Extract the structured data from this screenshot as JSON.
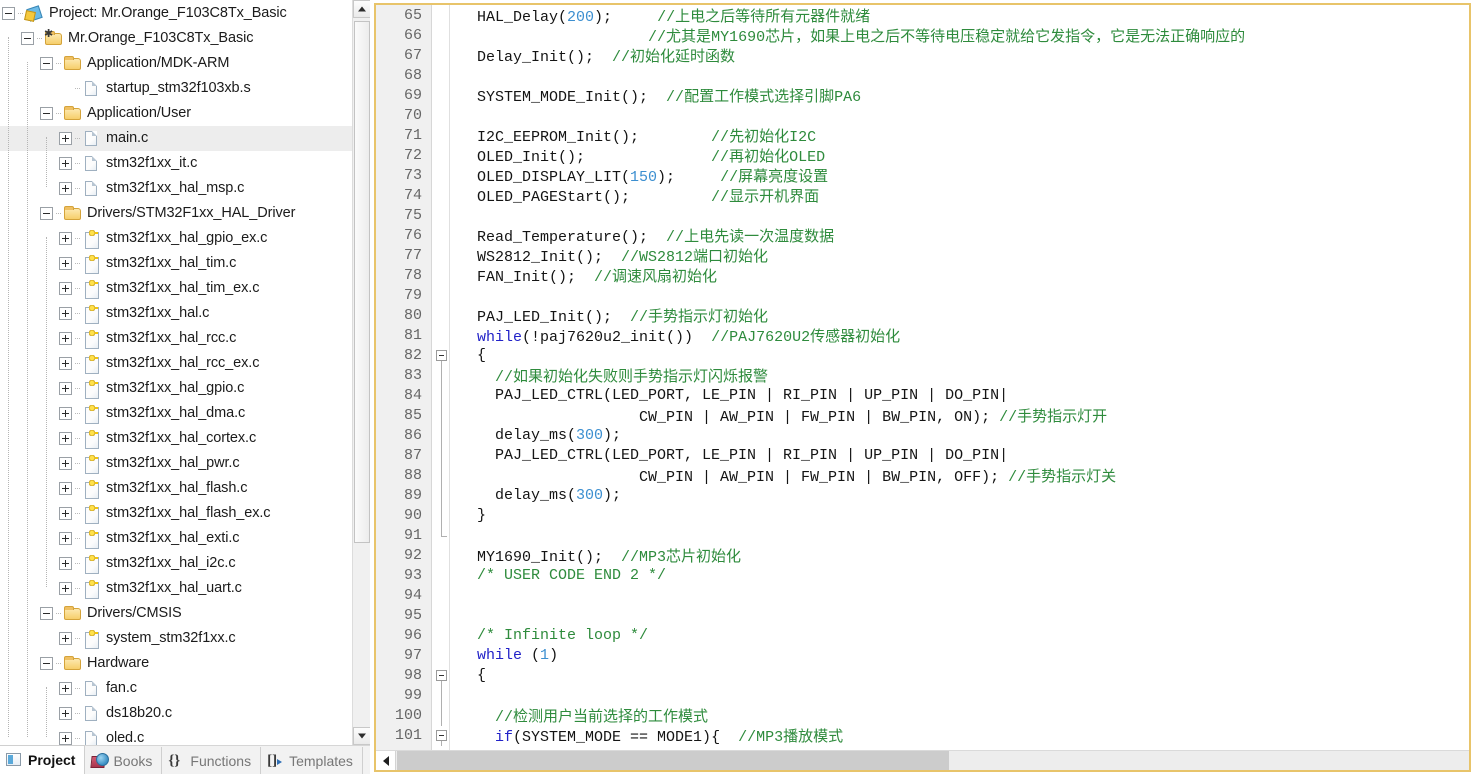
{
  "project_pane": {
    "tree": [
      {
        "depth": 0,
        "label": "Project: Mr.Orange_F103C8Tx_Basic",
        "icon": "project-icon",
        "expander": "minus",
        "selected": false
      },
      {
        "depth": 1,
        "label": "Mr.Orange_F103C8Tx_Basic",
        "icon": "target-icon",
        "expander": "minus",
        "selected": false
      },
      {
        "depth": 2,
        "label": "Application/MDK-ARM",
        "icon": "folder-icon",
        "expander": "minus",
        "selected": false
      },
      {
        "depth": 3,
        "label": "startup_stm32f103xb.s",
        "icon": "file-icon",
        "expander": "none",
        "selected": false
      },
      {
        "depth": 2,
        "label": "Application/User",
        "icon": "folder-icon",
        "expander": "minus",
        "selected": false
      },
      {
        "depth": 3,
        "label": "main.c",
        "icon": "file-icon",
        "expander": "plus",
        "selected": true
      },
      {
        "depth": 3,
        "label": "stm32f1xx_it.c",
        "icon": "file-icon",
        "expander": "plus",
        "selected": false
      },
      {
        "depth": 3,
        "label": "stm32f1xx_hal_msp.c",
        "icon": "file-icon",
        "expander": "plus",
        "selected": false
      },
      {
        "depth": 2,
        "label": "Drivers/STM32F1xx_HAL_Driver",
        "icon": "folder-icon",
        "expander": "minus",
        "selected": false
      },
      {
        "depth": 3,
        "label": "stm32f1xx_hal_gpio_ex.c",
        "icon": "file-key-icon",
        "expander": "plus",
        "selected": false
      },
      {
        "depth": 3,
        "label": "stm32f1xx_hal_tim.c",
        "icon": "file-key-icon",
        "expander": "plus",
        "selected": false
      },
      {
        "depth": 3,
        "label": "stm32f1xx_hal_tim_ex.c",
        "icon": "file-key-icon",
        "expander": "plus",
        "selected": false
      },
      {
        "depth": 3,
        "label": "stm32f1xx_hal.c",
        "icon": "file-key-icon",
        "expander": "plus",
        "selected": false
      },
      {
        "depth": 3,
        "label": "stm32f1xx_hal_rcc.c",
        "icon": "file-key-icon",
        "expander": "plus",
        "selected": false
      },
      {
        "depth": 3,
        "label": "stm32f1xx_hal_rcc_ex.c",
        "icon": "file-key-icon",
        "expander": "plus",
        "selected": false
      },
      {
        "depth": 3,
        "label": "stm32f1xx_hal_gpio.c",
        "icon": "file-key-icon",
        "expander": "plus",
        "selected": false
      },
      {
        "depth": 3,
        "label": "stm32f1xx_hal_dma.c",
        "icon": "file-key-icon",
        "expander": "plus",
        "selected": false
      },
      {
        "depth": 3,
        "label": "stm32f1xx_hal_cortex.c",
        "icon": "file-key-icon",
        "expander": "plus",
        "selected": false
      },
      {
        "depth": 3,
        "label": "stm32f1xx_hal_pwr.c",
        "icon": "file-key-icon",
        "expander": "plus",
        "selected": false
      },
      {
        "depth": 3,
        "label": "stm32f1xx_hal_flash.c",
        "icon": "file-key-icon",
        "expander": "plus",
        "selected": false
      },
      {
        "depth": 3,
        "label": "stm32f1xx_hal_flash_ex.c",
        "icon": "file-key-icon",
        "expander": "plus",
        "selected": false
      },
      {
        "depth": 3,
        "label": "stm32f1xx_hal_exti.c",
        "icon": "file-key-icon",
        "expander": "plus",
        "selected": false
      },
      {
        "depth": 3,
        "label": "stm32f1xx_hal_i2c.c",
        "icon": "file-key-icon",
        "expander": "plus",
        "selected": false
      },
      {
        "depth": 3,
        "label": "stm32f1xx_hal_uart.c",
        "icon": "file-key-icon",
        "expander": "plus",
        "selected": false
      },
      {
        "depth": 2,
        "label": "Drivers/CMSIS",
        "icon": "folder-icon",
        "expander": "minus",
        "selected": false
      },
      {
        "depth": 3,
        "label": "system_stm32f1xx.c",
        "icon": "file-key-icon",
        "expander": "plus",
        "selected": false
      },
      {
        "depth": 2,
        "label": "Hardware",
        "icon": "folder-icon",
        "expander": "minus",
        "selected": false
      },
      {
        "depth": 3,
        "label": "fan.c",
        "icon": "file-icon",
        "expander": "plus",
        "selected": false
      },
      {
        "depth": 3,
        "label": "ds18b20.c",
        "icon": "file-icon",
        "expander": "plus",
        "selected": false
      },
      {
        "depth": 3,
        "label": "oled.c",
        "icon": "file-icon",
        "expander": "plus",
        "selected": false
      }
    ],
    "tabs": [
      {
        "label": "Project",
        "icon": "project-tab-icon",
        "active": true
      },
      {
        "label": "Books",
        "icon": "books-icon",
        "active": false
      },
      {
        "label": "Functions",
        "icon": "functions-icon",
        "active": false
      },
      {
        "label": "Templates",
        "icon": "templates-icon",
        "active": false
      }
    ],
    "scrollbar": {
      "up_arrow": "▲",
      "down_arrow": "▼"
    }
  },
  "editor": {
    "first_line": 65,
    "last_line": 101,
    "lines": [
      {
        "n": 65,
        "fold": "none",
        "tokens": [
          {
            "t": "  HAL_Delay("
          },
          {
            "t": "200",
            "c": "num"
          },
          {
            "t": ");     "
          },
          {
            "t": "//上电之后等待所有元器件就绪",
            "c": "cmt"
          }
        ]
      },
      {
        "n": 66,
        "fold": "none",
        "tokens": [
          {
            "t": "                     "
          },
          {
            "t": "//尤其是MY1690芯片，如果上电之后不等待电压稳定就给它发指令，它是无法正确响应的",
            "c": "cmt"
          }
        ]
      },
      {
        "n": 67,
        "fold": "none",
        "tokens": [
          {
            "t": "  Delay_Init();  "
          },
          {
            "t": "//初始化延时函数",
            "c": "cmt"
          }
        ]
      },
      {
        "n": 68,
        "fold": "none",
        "tokens": [
          {
            "t": ""
          }
        ]
      },
      {
        "n": 69,
        "fold": "none",
        "tokens": [
          {
            "t": "  SYSTEM_MODE_Init();  "
          },
          {
            "t": "//配置工作模式选择引脚PA6",
            "c": "cmt"
          }
        ]
      },
      {
        "n": 70,
        "fold": "none",
        "tokens": [
          {
            "t": ""
          }
        ]
      },
      {
        "n": 71,
        "fold": "none",
        "tokens": [
          {
            "t": "  I2C_EEPROM_Init();        "
          },
          {
            "t": "//先初始化I2C",
            "c": "cmt"
          }
        ]
      },
      {
        "n": 72,
        "fold": "none",
        "tokens": [
          {
            "t": "  OLED_Init();              "
          },
          {
            "t": "//再初始化OLED",
            "c": "cmt"
          }
        ]
      },
      {
        "n": 73,
        "fold": "none",
        "tokens": [
          {
            "t": "  OLED_DISPLAY_LIT("
          },
          {
            "t": "150",
            "c": "num"
          },
          {
            "t": ");     "
          },
          {
            "t": "//屏幕亮度设置",
            "c": "cmt"
          }
        ]
      },
      {
        "n": 74,
        "fold": "none",
        "tokens": [
          {
            "t": "  OLED_PAGEStart();         "
          },
          {
            "t": "//显示开机界面",
            "c": "cmt"
          }
        ]
      },
      {
        "n": 75,
        "fold": "none",
        "tokens": [
          {
            "t": ""
          }
        ]
      },
      {
        "n": 76,
        "fold": "none",
        "tokens": [
          {
            "t": "  Read_Temperature();  "
          },
          {
            "t": "//上电先读一次温度数据",
            "c": "cmt"
          }
        ]
      },
      {
        "n": 77,
        "fold": "none",
        "tokens": [
          {
            "t": "  WS2812_Init();  "
          },
          {
            "t": "//WS2812端口初始化",
            "c": "cmt"
          }
        ]
      },
      {
        "n": 78,
        "fold": "none",
        "tokens": [
          {
            "t": "  FAN_Init();  "
          },
          {
            "t": "//调速风扇初始化",
            "c": "cmt"
          }
        ]
      },
      {
        "n": 79,
        "fold": "none",
        "tokens": [
          {
            "t": ""
          }
        ]
      },
      {
        "n": 80,
        "fold": "none",
        "tokens": [
          {
            "t": "  PAJ_LED_Init();  "
          },
          {
            "t": "//手势指示灯初始化",
            "c": "cmt"
          }
        ]
      },
      {
        "n": 81,
        "fold": "none",
        "tokens": [
          {
            "t": "  "
          },
          {
            "t": "while",
            "c": "kw"
          },
          {
            "t": "(!paj7620u2_init())  "
          },
          {
            "t": "//PAJ7620U2传感器初始化",
            "c": "cmt"
          }
        ]
      },
      {
        "n": 82,
        "fold": "box",
        "tokens": [
          {
            "t": "  {"
          }
        ]
      },
      {
        "n": 83,
        "fold": "line",
        "tokens": [
          {
            "t": "    "
          },
          {
            "t": "//如果初始化失败则手势指示灯闪烁报警",
            "c": "cmt"
          }
        ]
      },
      {
        "n": 84,
        "fold": "line",
        "tokens": [
          {
            "t": "    PAJ_LED_CTRL(LED_PORT, LE_PIN | RI_PIN | UP_PIN | DO_PIN|"
          }
        ]
      },
      {
        "n": 85,
        "fold": "line",
        "tokens": [
          {
            "t": "                    CW_PIN | AW_PIN | FW_PIN | BW_PIN, ON); "
          },
          {
            "t": "//手势指示灯开",
            "c": "cmt"
          }
        ]
      },
      {
        "n": 86,
        "fold": "line",
        "tokens": [
          {
            "t": "    delay_ms("
          },
          {
            "t": "300",
            "c": "num"
          },
          {
            "t": ");"
          }
        ]
      },
      {
        "n": 87,
        "fold": "line",
        "tokens": [
          {
            "t": "    PAJ_LED_CTRL(LED_PORT, LE_PIN | RI_PIN | UP_PIN | DO_PIN|"
          }
        ]
      },
      {
        "n": 88,
        "fold": "line",
        "tokens": [
          {
            "t": "                    CW_PIN | AW_PIN | FW_PIN | BW_PIN, OFF); "
          },
          {
            "t": "//手势指示灯关",
            "c": "cmt"
          }
        ]
      },
      {
        "n": 89,
        "fold": "line",
        "tokens": [
          {
            "t": "    delay_ms("
          },
          {
            "t": "300",
            "c": "num"
          },
          {
            "t": ");"
          }
        ]
      },
      {
        "n": 90,
        "fold": "line",
        "tokens": [
          {
            "t": "  }"
          }
        ]
      },
      {
        "n": 91,
        "fold": "end",
        "tokens": [
          {
            "t": ""
          }
        ]
      },
      {
        "n": 92,
        "fold": "none",
        "tokens": [
          {
            "t": "  MY1690_Init();  "
          },
          {
            "t": "//MP3芯片初始化",
            "c": "cmt"
          }
        ]
      },
      {
        "n": 93,
        "fold": "none",
        "tokens": [
          {
            "t": "  "
          },
          {
            "t": "/* USER CODE END 2 */",
            "c": "cmt"
          }
        ]
      },
      {
        "n": 94,
        "fold": "none",
        "tokens": [
          {
            "t": ""
          }
        ]
      },
      {
        "n": 95,
        "fold": "none",
        "tokens": [
          {
            "t": ""
          }
        ]
      },
      {
        "n": 96,
        "fold": "none",
        "tokens": [
          {
            "t": "  "
          },
          {
            "t": "/* Infinite loop */",
            "c": "cmt"
          }
        ]
      },
      {
        "n": 97,
        "fold": "none",
        "tokens": [
          {
            "t": "  "
          },
          {
            "t": "while",
            "c": "kw"
          },
          {
            "t": " ("
          },
          {
            "t": "1",
            "c": "num"
          },
          {
            "t": ")"
          }
        ]
      },
      {
        "n": 98,
        "fold": "box",
        "tokens": [
          {
            "t": "  {"
          }
        ]
      },
      {
        "n": 99,
        "fold": "line",
        "tokens": [
          {
            "t": ""
          }
        ]
      },
      {
        "n": 100,
        "fold": "line",
        "tokens": [
          {
            "t": "    "
          },
          {
            "t": "//检测用户当前选择的工作模式",
            "c": "cmt"
          }
        ]
      },
      {
        "n": 101,
        "fold": "box",
        "tokens": [
          {
            "t": "    "
          },
          {
            "t": "if",
            "c": "kw"
          },
          {
            "t": "(SYSTEM_MODE == MODE1){  "
          },
          {
            "t": "//MP3播放模式",
            "c": "cmt"
          }
        ]
      }
    ],
    "hscroll": {
      "left_arrow": "‹"
    }
  },
  "colors": {
    "comment": "#2e8b3c",
    "keyword": "#2222c8",
    "number": "#3c8fd0",
    "selection": "#ededed",
    "frame_border": "#e8c46a"
  }
}
